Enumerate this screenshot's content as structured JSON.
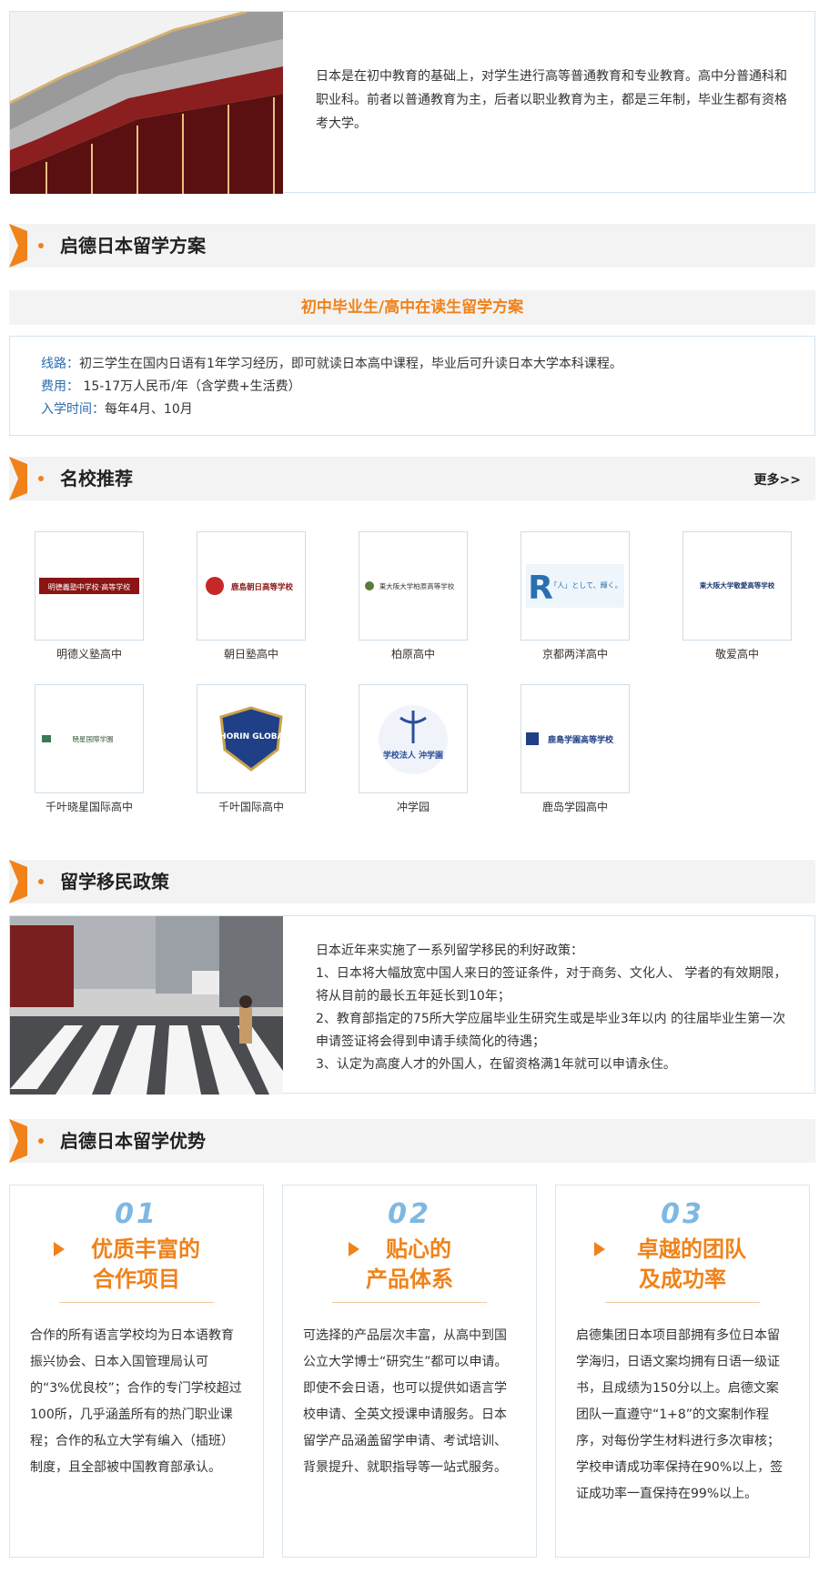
{
  "intro": {
    "text": "日本是在初中教育的基础上，对学生进行高等普通教育和专业教育。高中分普通科和职业科。前者以普通教育为主，后者以职业教育为主，都是三年制，毕业生都有资格考大学。"
  },
  "sections": {
    "plan": {
      "title": "启德日本留学方案"
    },
    "schools": {
      "title": "名校推荐",
      "more": "更多>>"
    },
    "policy": {
      "title": "留学移民政策"
    },
    "advantages": {
      "title": "启德日本留学优势"
    }
  },
  "plan": {
    "subtitle": "初中毕业生/高中在读生留学方案",
    "route_key": "线路：",
    "route_val": "初三学生在国内日语有1年学习经历，即可就读日本高中课程，毕业后可升读日本大学本科课程。",
    "fee_key": "费用：",
    "fee_val": " 15-17万人民币/年（含学费+生活费）",
    "time_key": "入学时间：",
    "time_val": "每年4月、10月"
  },
  "schools": [
    {
      "name": "明德义塾高中",
      "logo_text": "明德義塾中学校·高等学校"
    },
    {
      "name": "朝日塾高中",
      "logo_text": "鹿島朝日高等学校"
    },
    {
      "name": "柏原高中",
      "logo_text": "東大阪大学柏原高等学校"
    },
    {
      "name": "京都两洋高中",
      "logo_text": "「人」として、輝く。"
    },
    {
      "name": "敬爱高中",
      "logo_text": "東大阪大学敬愛高等学校"
    },
    {
      "name": "千叶晓星国际高中",
      "logo_text": "暁星国際学園"
    },
    {
      "name": "千叶国际高中",
      "logo_text": "SHORIN GLOBAL"
    },
    {
      "name": "冲学园",
      "logo_text": "学校法人 沖学園"
    },
    {
      "name": "鹿岛学园高中",
      "logo_text": "鹿島学園高等学校"
    }
  ],
  "policy": {
    "line1": "日本近年来实施了一系列留学移民的利好政策：",
    "line2": "1、日本将大幅放宽中国人来日的签证条件，对于商务、文化人、 学者的有效期限，将从目前的最长五年延长到10年；",
    "line3": "2、教育部指定的75所大学应届毕业生研究生或是毕业3年以内 的往届毕业生第一次申请签证将会得到申请手续简化的待遇；",
    "line4": "3、认定为高度人才的外国人，在留资格满1年就可以申请永住。"
  },
  "advantages": [
    {
      "num": "01",
      "title1": "优质丰富的",
      "title2": "合作项目",
      "text": "合作的所有语言学校均为日本语教育振兴协会、日本入国管理局认可的“3%优良校”；合作的专门学校超过100所，几乎涵盖所有的热门职业课程；合作的私立大学有编入（插班）制度，且全部被中国教育部承认。"
    },
    {
      "num": "02",
      "title1": "贴心的",
      "title2": "产品体系",
      "text": "可选择的产品层次丰富，从高中到国公立大学博士“研究生”都可以申请。即使不会日语，也可以提供如语言学校申请、全英文授课申请服务。日本留学产品涵盖留学申请、考试培训、背景提升、就职指导等一站式服务。"
    },
    {
      "num": "03",
      "title1": "卓越的团队",
      "title2": "及成功率",
      "text": "启德集团日本项目部拥有多位日本留学海归，日语文案均拥有日语一级证书，且成绩为150分以上。启德文案团队一直遵守“1+8”的文案制作程序，对每份学生材料进行多次审核；学校申请成功率保持在90%以上，签证成功率一直保持在99%以上。"
    }
  ],
  "colors": {
    "accent": "#f08219",
    "blue": "#2b6cb0",
    "num_blue": "#7db8e3"
  }
}
